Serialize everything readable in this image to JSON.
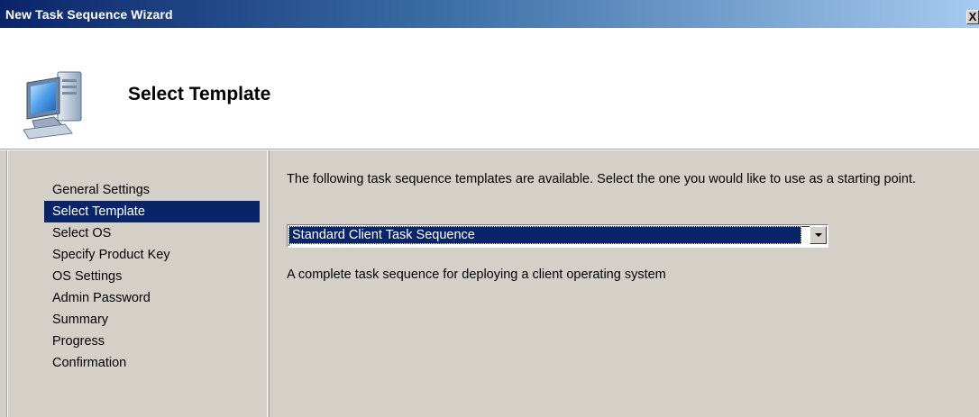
{
  "window": {
    "title": "New Task Sequence Wizard",
    "close_label": "X"
  },
  "header": {
    "page_title": "Select Template",
    "icon": "computer-icon"
  },
  "nav": {
    "items": [
      {
        "label": "General Settings",
        "selected": false
      },
      {
        "label": "Select Template",
        "selected": true
      },
      {
        "label": "Select OS",
        "selected": false
      },
      {
        "label": "Specify Product Key",
        "selected": false
      },
      {
        "label": "OS Settings",
        "selected": false
      },
      {
        "label": "Admin Password",
        "selected": false
      },
      {
        "label": "Summary",
        "selected": false
      },
      {
        "label": "Progress",
        "selected": false
      },
      {
        "label": "Confirmation",
        "selected": false
      }
    ]
  },
  "main": {
    "instructions": "The following task sequence templates are available.  Select the one you would like to use as a starting point.",
    "template_select": {
      "selected": "Standard Client Task Sequence"
    },
    "description": "A complete task sequence for deploying a client operating system"
  },
  "colors": {
    "titlebar_start": "#0a246a",
    "titlebar_end": "#a6caf0",
    "selection": "#0a246a",
    "dialog_face": "#d4d0c8"
  }
}
